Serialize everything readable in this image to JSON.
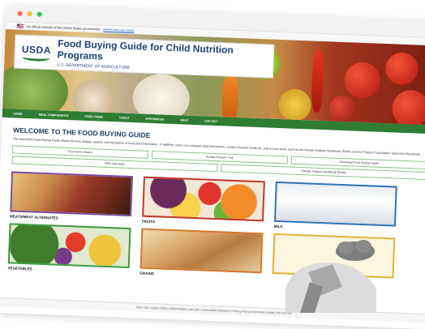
{
  "window": {
    "buttons": [
      {
        "name": "close",
        "color": "#ff5f57"
      },
      {
        "name": "minimize",
        "color": "#febc2e"
      },
      {
        "name": "zoom",
        "color": "#28c840"
      }
    ]
  },
  "gov_banner": {
    "text": "An official website of the United States government",
    "link": "Here's how you know"
  },
  "header": {
    "logo_text": "USDA",
    "title": "Food Buying Guide for Child Nutrition Programs",
    "subtitle": "U.S. DEPARTMENT OF AGRICULTURE"
  },
  "nav": {
    "items": [
      "HOME",
      "MEAL COMPONENTS",
      "FOOD ITEMS",
      "TOOLS",
      "APPENDICES",
      "HELP",
      "LOG OUT"
    ]
  },
  "main": {
    "heading": "WELCOME TO THE FOOD BUYING GUIDE",
    "intro": "The interactive Food Buying Guide allows for easy display, search, and navigation of food yield information. In addition, users can compare yield information, create a favorite foods list, and access tools, such as the Recipe Analysis Workbook (RAW) and the Product Formulation Statement Workbook.",
    "row1": [
      "Food Items Search",
      "Exhibit A Grains Tool",
      "Download Food Buying Guide"
    ],
    "row2": [
      "FBG Calculator",
      "Recipe Analysis Workbook (RAW)"
    ],
    "tiles": [
      {
        "label": "MEATS/MEAT ALTERNATES",
        "border": "#7b4fa0"
      },
      {
        "label": "FRUITS",
        "border": "#c0392b"
      },
      {
        "label": "MILK",
        "border": "#2f73b8"
      },
      {
        "label": "VEGETABLES",
        "border": "#3c9b41"
      },
      {
        "label": "GRAINS",
        "border": "#d6762a"
      },
      {
        "label": "",
        "border": "#e0b23a"
      }
    ]
  },
  "footer": {
    "text": "FNS  |  OIG  |  USDA  |  FOIA  |  USDA Policies and Links  |  Accessibility Statement  |  Privacy Policy  |  Information Quality  |  No Fear Act"
  }
}
